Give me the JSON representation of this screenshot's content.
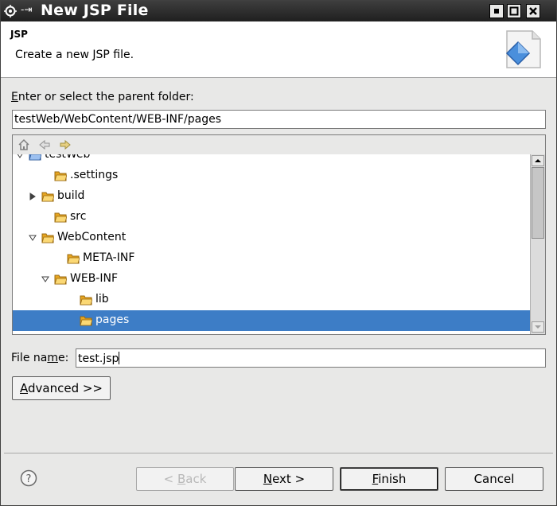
{
  "window": {
    "title": "New JSP File",
    "pin_glyph": "-⇥",
    "controls": [
      "minimize-icon",
      "maximize-icon",
      "close-icon"
    ]
  },
  "header": {
    "title": "JSP",
    "description": "Create a new JSP file.",
    "image": "jsp-wizard-banner-icon"
  },
  "parent_folder": {
    "label_prefix": "E",
    "label_rest": "nter or select the parent folder:",
    "value": "testWeb/WebContent/WEB-INF/pages"
  },
  "tree_toolbar": {
    "icons": [
      "home-icon",
      "back-icon",
      "forward-icon"
    ]
  },
  "tree": {
    "items": [
      {
        "label": "testWeb",
        "expanded": true
      },
      {
        "label": ".settings"
      },
      {
        "label": "build",
        "expandable": true
      },
      {
        "label": "src"
      },
      {
        "label": "WebContent",
        "expanded": true
      },
      {
        "label": "META-INF"
      },
      {
        "label": "WEB-INF",
        "expanded": true
      },
      {
        "label": "lib"
      },
      {
        "label": "pages",
        "selected": true
      }
    ]
  },
  "file_name": {
    "label_pre": "File na",
    "label_mnemonic": "m",
    "label_post": "e:",
    "value": "test.jsp"
  },
  "buttons": {
    "advanced": {
      "mnemonic": "A",
      "rest": "dvanced >>"
    },
    "back": {
      "pre": "< ",
      "mnemonic": "B",
      "rest": "ack"
    },
    "next": {
      "mnemonic": "N",
      "rest": "ext >"
    },
    "finish": {
      "mnemonic": "F",
      "rest": "inish"
    },
    "cancel": {
      "label": "Cancel"
    }
  },
  "colors": {
    "selection": "#3d7dc6",
    "folder": "#e7a520"
  }
}
